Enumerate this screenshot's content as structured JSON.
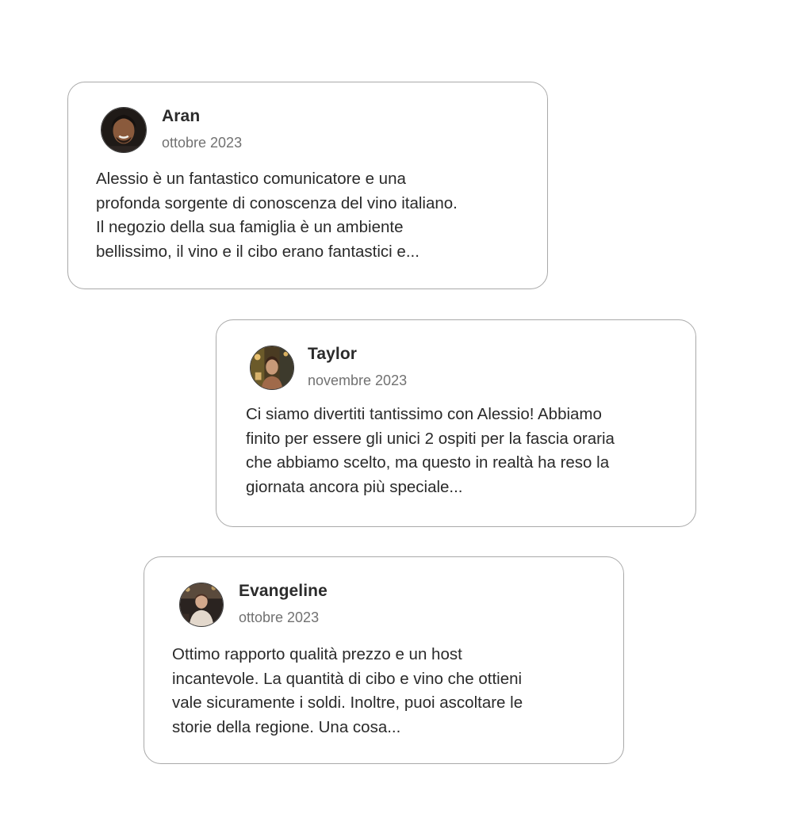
{
  "reviews": [
    {
      "name": "Aran",
      "date": "ottobre 2023",
      "lines": [
        "Alessio è un fantastico comunicatore e una",
        "profonda sorgente di conoscenza del vino italiano.",
        "Il negozio della sua famiglia è un ambiente",
        "bellissimo, il vino e il cibo erano fantastici e..."
      ],
      "avatar": "profile-photo"
    },
    {
      "name": "Taylor",
      "date": "novembre 2023",
      "lines": [
        "Ci siamo divertiti tantissimo con Alessio! Abbiamo",
        "finito per essere gli unici 2 ospiti per la fascia oraria",
        "che abbiamo scelto, ma questo in realtà ha reso la",
        "giornata ancora più speciale..."
      ],
      "avatar": "profile-photo"
    },
    {
      "name": "Evangeline",
      "date": "ottobre 2023",
      "lines": [
        "Ottimo rapporto qualità prezzo e un host",
        "incantevole. La quantità di cibo e vino che ottieni",
        "vale sicuramente i soldi. Inoltre, puoi ascoltare le",
        "storie della regione. Una cosa..."
      ],
      "avatar": "profile-photo"
    }
  ],
  "colors": {
    "card_border": "#a9a9a9",
    "name": "#2b2b2b",
    "date": "#717171",
    "text": "#2a2a2a"
  }
}
